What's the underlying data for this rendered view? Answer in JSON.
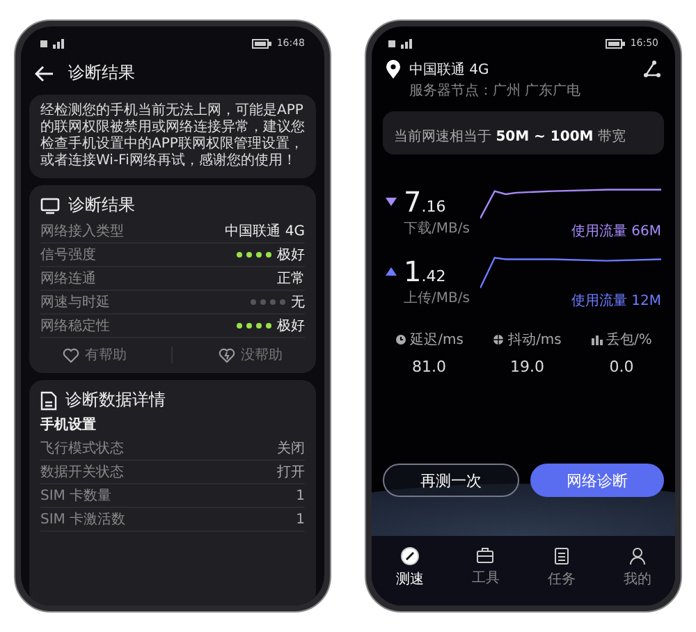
{
  "left_phone": {
    "status_bar": {
      "time": "16:48"
    },
    "header": {
      "title": "诊断结果"
    },
    "message": "经检测您的手机当前无法上网，可能是APP的联网权限被禁用或网络连接异常，建议您检查手机设置中的APP联网权限管理设置，或者连接Wi-Fi网络再试，感谢您的使用！",
    "result_card": {
      "title": "诊断结果",
      "rows": [
        {
          "kind": "text",
          "label": "网络接入类型",
          "value": "中国联通 4G"
        },
        {
          "kind": "dots",
          "label": "信号强度",
          "stars": 4,
          "value": "极好"
        },
        {
          "kind": "text",
          "label": "网络连通",
          "value": "正常"
        },
        {
          "kind": "dots",
          "label": "网速与时延",
          "stars": 0,
          "value": "无"
        },
        {
          "kind": "dots",
          "label": "网络稳定性",
          "stars": 4,
          "value": "极好"
        }
      ],
      "feedback": [
        {
          "kind": "heart",
          "label": "有帮助"
        },
        {
          "kind": "broken-heart",
          "label": "没帮助"
        }
      ]
    },
    "details_card": {
      "title": "诊断数据详情",
      "section": "手机设置",
      "rows": [
        {
          "label": "飞行模式状态",
          "value": "关闭"
        },
        {
          "label": "数据开关状态",
          "value": "打开"
        },
        {
          "label": "SIM 卡数量",
          "value": "1"
        },
        {
          "label": "SIM 卡激活数",
          "value": "1"
        }
      ]
    }
  },
  "right_phone": {
    "status_bar": {
      "time": "16:50"
    },
    "location": {
      "carrier": "中国联通 4G",
      "server": "服务器节点：广州 广东广电"
    },
    "speed_note": "当前网速相当于 **50M ~ 100M** 带宽",
    "speeds": [
      {
        "kind": "download",
        "integer": "7",
        "decimal": ".16",
        "unit": "下载/MB/s",
        "usage": "使用流量 66M",
        "color": "#a78bfa"
      },
      {
        "kind": "upload",
        "integer": "1",
        "decimal": ".42",
        "unit": "上传/MB/s",
        "usage": "使用流量 12M",
        "color": "#6d7cff"
      }
    ],
    "stats": [
      {
        "kind": "latency",
        "label": "延迟/ms",
        "value": "81.0"
      },
      {
        "kind": "jitter",
        "label": "抖动/ms",
        "value": "19.0"
      },
      {
        "kind": "loss",
        "label": "丢包/%",
        "value": "0.0"
      }
    ],
    "buttons": [
      {
        "kind": "outline",
        "label": "再测一次"
      },
      {
        "kind": "primary",
        "label": "网络诊断"
      }
    ],
    "nav": [
      {
        "kind": "speed",
        "label": "测速",
        "selected": true
      },
      {
        "kind": "tools",
        "label": "工具",
        "selected": false
      },
      {
        "kind": "tasks",
        "label": "任务",
        "selected": false
      },
      {
        "kind": "me",
        "label": "我的",
        "selected": false
      }
    ]
  }
}
